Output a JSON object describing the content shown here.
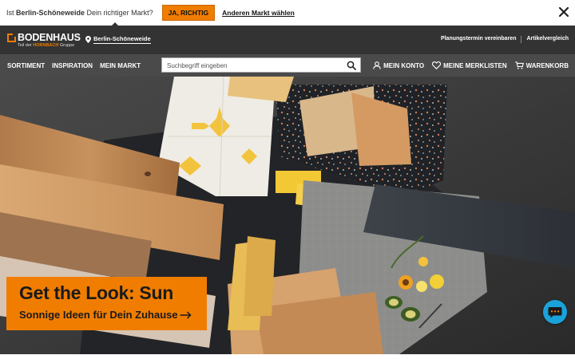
{
  "market_bar": {
    "question_prefix": "Ist ",
    "market_name": "Berlin-Schöneweide",
    "question_suffix": " Dein richtiger Markt?",
    "confirm_label": "JA, RICHTIG",
    "other_label": "Anderen Markt wählen"
  },
  "header": {
    "logo_name": "BODENHAUS",
    "logo_sub_prefix": "Teil der ",
    "logo_sub_brand": "HORNBACH",
    "logo_sub_suffix": " Gruppe",
    "location": "Berlin-Schöneweide",
    "links": [
      "Planungstermin vereinbaren",
      "Artikelvergleich"
    ]
  },
  "nav": {
    "menu": [
      "SORTIMENT",
      "INSPIRATION",
      "MEIN MARKT"
    ],
    "search_placeholder": "Suchbegriff eingeben",
    "account": "MEIN KONTO",
    "wishlist": "MEINE MERKLISTEN",
    "cart": "WARENKORB"
  },
  "hero": {
    "title": "Get the Look: Sun",
    "subtitle": "Sonnige Ideen für Dein Zuhause"
  },
  "colors": {
    "accent": "#f07d00",
    "header_bg": "#333333",
    "nav_bg": "#4a4a4a",
    "chat": "#1aa3d9"
  },
  "icons": [
    "close-icon",
    "location-pin-icon",
    "search-icon",
    "user-icon",
    "heart-icon",
    "cart-icon",
    "arrow-right-icon",
    "chat-icon"
  ]
}
